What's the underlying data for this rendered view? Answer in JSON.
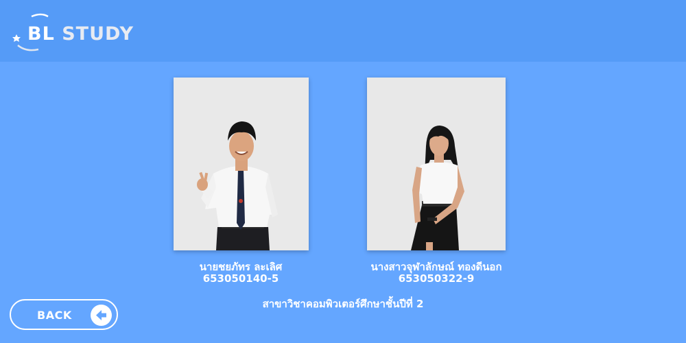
{
  "header": {
    "logo_part1": "BL",
    "logo_part2": "STUDY"
  },
  "members": [
    {
      "name": "นายชยภัทร ละเลิศ",
      "student_id": "653050140-5"
    },
    {
      "name": "นางสาวจุฬาลักษณ์ ทองดีนอก",
      "student_id": "653050322-9"
    }
  ],
  "program": "สาขาวิชาคอมพิวเตอร์ศึกษาชั้นปีที่ 2",
  "back_button": {
    "label": "BACK",
    "icon": "arrow-left-icon"
  },
  "colors": {
    "background": "#64a6ff",
    "header": "#559bf7",
    "text": "#ffffff"
  }
}
